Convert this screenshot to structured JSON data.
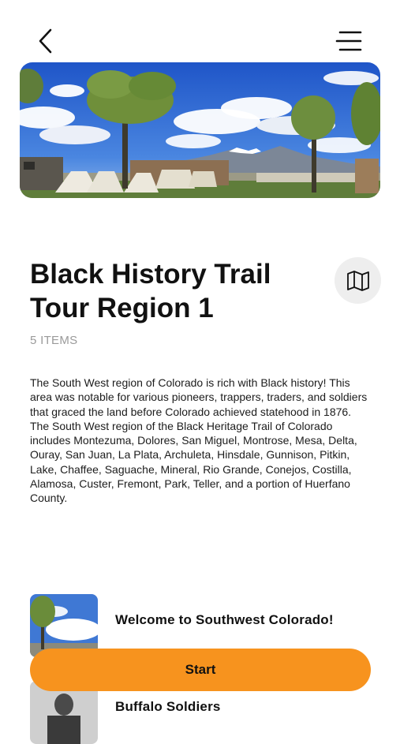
{
  "nav": {
    "back_icon": "chevron-left-icon",
    "menu_icon": "menu-icon"
  },
  "hero": {
    "image": "fort-tents-landscape"
  },
  "header": {
    "title": "Black History Trail Tour Region 1",
    "item_count": "5 ITEMS",
    "map_icon": "map-icon"
  },
  "description": "The South West region of Colorado is rich with Black history! This area was notable for various pioneers, trappers, traders, and soldiers that graced the land before Colorado achieved statehood in 1876. The South West region of the Black Heritage Trail of Colorado includes Montezuma, Dolores, San Miguel, Montrose, Mesa, Delta, Ouray, San Juan, La Plata, Archuleta, Hinsdale, Gunnison, Pitkin, Lake, Chaffee, Saguache, Mineral, Rio Grande, Conejos, Costilla, Alamosa, Custer, Fremont, Park, Teller, and a portion of Huerfano County.",
  "tour_items": [
    {
      "label": "Welcome to Southwest Colorado!"
    },
    {
      "label": "Buffalo Soldiers"
    }
  ],
  "start_button": {
    "label": "Start"
  },
  "colors": {
    "accent": "#f7931e",
    "map_button_bg": "#eeeeee",
    "muted_text": "#9a9a9a"
  }
}
